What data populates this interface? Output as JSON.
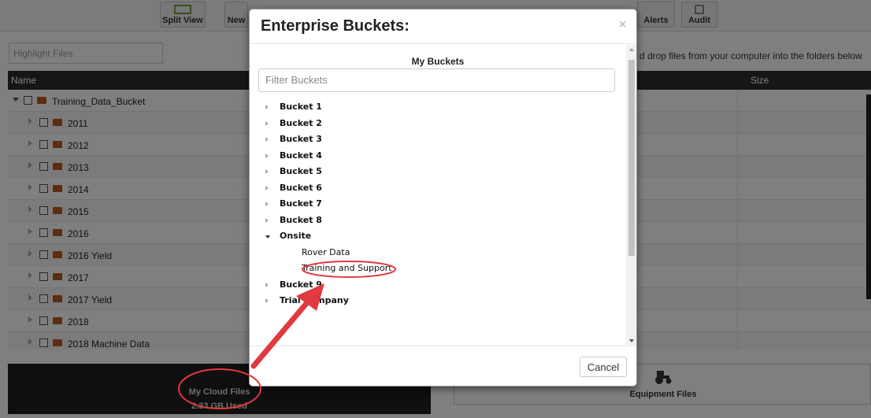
{
  "toolbar": {
    "split_view": "Split View",
    "new_partial": "New",
    "alerts_partial": "Alerts",
    "audit_partial": "Audit"
  },
  "background": {
    "highlight_placeholder": "Highlight Files",
    "drag_note": "d drop files from your computer into the folders below",
    "columns": {
      "name": "Name",
      "size": "Size"
    },
    "root": "Training_Data_Bucket",
    "folders": [
      "2011",
      "2012",
      "2013",
      "2014",
      "2015",
      "2016",
      "2016 Yield",
      "2017",
      "2017 Yield",
      "2018",
      "2018 Machine Data"
    ],
    "cloud": {
      "title": "My Cloud Files",
      "usage": "2.33 GB Used"
    },
    "equipment": {
      "title": "Equipment Files"
    }
  },
  "modal": {
    "title": "Enterprise Buckets:",
    "close": "×",
    "section": "My Buckets",
    "filter_placeholder": "Filter Buckets",
    "buckets": [
      {
        "label": "Bucket 1",
        "bold": true,
        "expanded": false
      },
      {
        "label": "Bucket 2",
        "bold": true,
        "expanded": false
      },
      {
        "label": "Bucket 3",
        "bold": true,
        "expanded": false
      },
      {
        "label": "Bucket 4",
        "bold": true,
        "expanded": false
      },
      {
        "label": "Bucket 5",
        "bold": true,
        "expanded": false
      },
      {
        "label": "Bucket 6",
        "bold": true,
        "expanded": false
      },
      {
        "label": "Bucket 7",
        "bold": true,
        "expanded": false
      },
      {
        "label": "Bucket 8",
        "bold": true,
        "expanded": false
      },
      {
        "label": "Onsite",
        "bold": true,
        "expanded": true,
        "children": [
          "Rover Data",
          "Training and Support"
        ]
      },
      {
        "label": "Bucket 9",
        "bold": true,
        "expanded": false
      },
      {
        "label": "Trial Company",
        "bold": true,
        "expanded": false
      }
    ],
    "cancel": "Cancel"
  },
  "colors": {
    "annotation": "#e0393e",
    "folder": "#b85a1c",
    "toolbar_icon": "#6a9e3c"
  }
}
